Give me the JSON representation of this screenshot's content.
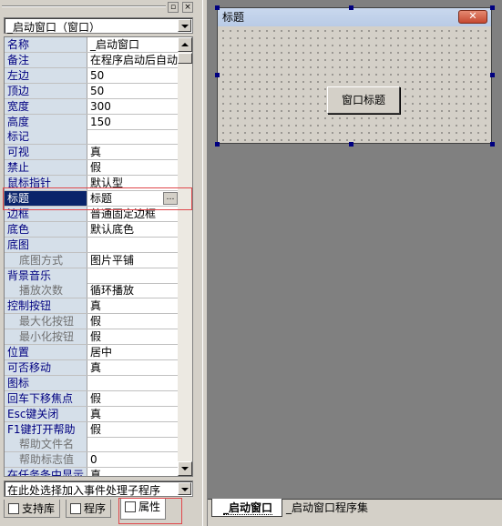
{
  "left_panel": {
    "object_selector": "_启动窗口（窗口）",
    "event_selector": "在此处选择加入事件处理子程序",
    "properties": [
      {
        "name": "名称",
        "value": "_启动窗口",
        "sub": false
      },
      {
        "name": "备注",
        "value": "在程序启动后自动",
        "sub": false
      },
      {
        "name": "左边",
        "value": "50",
        "sub": false
      },
      {
        "name": "顶边",
        "value": "50",
        "sub": false
      },
      {
        "name": "宽度",
        "value": "300",
        "sub": false
      },
      {
        "name": "高度",
        "value": "150",
        "sub": false
      },
      {
        "name": "标记",
        "value": "",
        "sub": false
      },
      {
        "name": "可视",
        "value": "真",
        "sub": false
      },
      {
        "name": "禁止",
        "value": "假",
        "sub": false
      },
      {
        "name": "鼠标指针",
        "value": "默认型",
        "sub": false
      },
      {
        "name": "标题",
        "value": "标题",
        "sub": false,
        "selected": true
      },
      {
        "name": "边框",
        "value": "普通固定边框",
        "sub": false
      },
      {
        "name": "底色",
        "value": "默认底色",
        "sub": false
      },
      {
        "name": "底图",
        "value": "",
        "sub": false
      },
      {
        "name": "底图方式",
        "value": "图片平铺",
        "sub": true
      },
      {
        "name": "背景音乐",
        "value": "",
        "sub": false
      },
      {
        "name": "播放次数",
        "value": "循环播放",
        "sub": true
      },
      {
        "name": "控制按钮",
        "value": "真",
        "sub": false
      },
      {
        "name": "最大化按钮",
        "value": "假",
        "sub": true
      },
      {
        "name": "最小化按钮",
        "value": "假",
        "sub": true
      },
      {
        "name": "位置",
        "value": "居中",
        "sub": false
      },
      {
        "name": "可否移动",
        "value": "真",
        "sub": false
      },
      {
        "name": "图标",
        "value": "",
        "sub": false
      },
      {
        "name": "回车下移焦点",
        "value": "假",
        "sub": false
      },
      {
        "name": "Esc键关闭",
        "value": "真",
        "sub": false
      },
      {
        "name": "F1键打开帮助",
        "value": "假",
        "sub": false
      },
      {
        "name": "帮助文件名",
        "value": "",
        "sub": true
      },
      {
        "name": "帮助标志值",
        "value": "0",
        "sub": true
      },
      {
        "name": "在任务条中显示",
        "value": "真",
        "sub": false
      }
    ],
    "tabs": [
      {
        "label": "支持库",
        "icon": "library-icon"
      },
      {
        "label": "程序",
        "icon": "program-icon"
      },
      {
        "label": "属性",
        "icon": "properties-icon",
        "active": true
      }
    ]
  },
  "designer": {
    "form_title": "标题",
    "form_close": "✕",
    "button_label": "窗口标题"
  },
  "right_tabs": [
    {
      "label": "_启动窗口",
      "active": true
    },
    {
      "label": "_启动窗口程序集",
      "active": false
    }
  ],
  "colors": {
    "selection": "#0a246a",
    "name_column": "#d5dfe9",
    "highlight_box": "#e0474b"
  }
}
